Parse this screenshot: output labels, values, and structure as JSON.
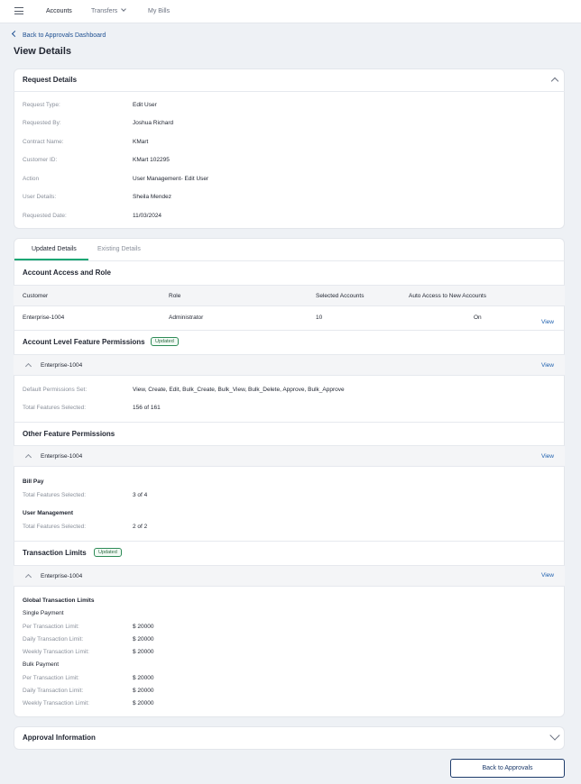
{
  "nav": {
    "items": [
      {
        "label": "Accounts"
      },
      {
        "label": "Transfers"
      },
      {
        "label": "My Bills"
      }
    ]
  },
  "back_link": "Back to Approvals Dashboard",
  "page_title": "View Details",
  "request_details": {
    "title": "Request Details",
    "rows": [
      {
        "label": "Request Type:",
        "value": "Edit User"
      },
      {
        "label": "Requested By:",
        "value": "Joshua Richard"
      },
      {
        "label": "Contract Name:",
        "value": "KMart"
      },
      {
        "label": "Customer ID:",
        "value": "KMart 102295"
      },
      {
        "label": "Action",
        "value": "User Management- Edit User"
      },
      {
        "label": "User Details:",
        "value": "Sheila Mendez"
      },
      {
        "label": "Requested Date:",
        "value": "11/03/2024"
      }
    ]
  },
  "tabs": [
    {
      "label": "Updated Details",
      "active": true
    },
    {
      "label": "Existing Details",
      "active": false
    }
  ],
  "account_access": {
    "title": "Account Access and Role",
    "headers": [
      "Customer",
      "Role",
      "Selected Accounts",
      "Auto Access to New Accounts"
    ],
    "row": {
      "customer": "Enterprise-1004",
      "role": "Administrator",
      "selected": "10",
      "auto": "On",
      "view": "View"
    }
  },
  "account_level": {
    "title": "Account Level Feature Permissions",
    "badge": "Updated",
    "group": "Enterprise-1004",
    "view": "View",
    "rows": [
      {
        "label": "Default Permissions Set:",
        "value": "View, Create, Edit, Bulk_Create, Bulk_View, Bulk_Delete, Approve, Bulk_Approve"
      },
      {
        "label": "Total Features Selected:",
        "value": "156 of 161"
      }
    ]
  },
  "other_feature": {
    "title": "Other Feature Permissions",
    "group": "Enterprise-1004",
    "view": "View",
    "sections": [
      {
        "name": "Bill Pay",
        "label": "Total Features Selected:",
        "value": "3 of 4"
      },
      {
        "name": "User Management",
        "label": "Total Features Selected:",
        "value": "2 of 2"
      }
    ]
  },
  "transaction_limits": {
    "title": "Transaction Limits",
    "badge": "Updated",
    "group": "Enterprise-1004",
    "view": "View",
    "global_heading": "Global Transaction Limits",
    "single": {
      "heading": "Single Payment",
      "rows": [
        {
          "label": "Per Transaction Limit:",
          "value": "$ 20000"
        },
        {
          "label": "Daily Transaction Limit:",
          "value": "$ 20000"
        },
        {
          "label": "Weekly Transaction Limit:",
          "value": "$ 20000"
        }
      ]
    },
    "bulk": {
      "heading": "Bulk Payment",
      "rows": [
        {
          "label": "Per Transaction Limit:",
          "value": "$ 20000"
        },
        {
          "label": "Daily Transaction Limit:",
          "value": "$ 20000"
        },
        {
          "label": "Weekly Transaction Limit:",
          "value": "$ 20000"
        }
      ]
    }
  },
  "approval_information": {
    "title": "Approval Information"
  },
  "back_button": "Back to Approvals",
  "colors": {
    "accent": "#17a673",
    "link": "#1d5fae",
    "primary_dark": "#1d3b6b"
  },
  "icons": [
    "menu-icon",
    "chevron-down-icon",
    "chevron-left-icon",
    "chevron-up-icon"
  ]
}
